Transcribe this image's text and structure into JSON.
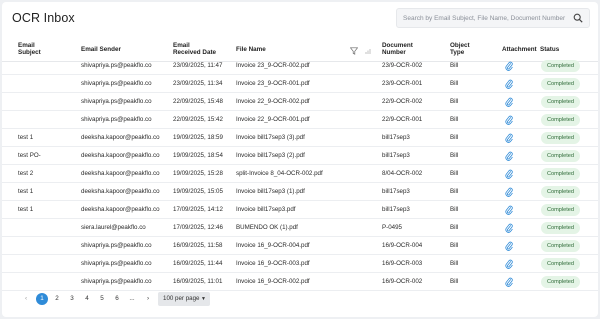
{
  "page": {
    "title": "OCR Inbox"
  },
  "search": {
    "placeholder": "Search by Email Subject, File Name, Document Number"
  },
  "table": {
    "columns": {
      "subject": [
        "Email",
        "Subject"
      ],
      "sender": "Email Sender",
      "received": [
        "Email",
        "Received Date"
      ],
      "file": "File Name",
      "doc": [
        "Document",
        "Number"
      ],
      "type": [
        "Object",
        "Type"
      ],
      "attachment": "Attachment",
      "status": "Status"
    },
    "rows": [
      {
        "subject": "",
        "sender": "shivapriya.ps@peakflo.co",
        "received": "23/09/2025, 11:47",
        "file": "Invoice 23_9-OCR-002.pdf",
        "doc": "23/9-OCR-002",
        "type": "Bill",
        "status": "Completed"
      },
      {
        "subject": "",
        "sender": "shivapriya.ps@peakflo.co",
        "received": "23/09/2025, 11:34",
        "file": "Invoice 23_9-OCR-001.pdf",
        "doc": "23/9-OCR-001",
        "type": "Bill",
        "status": "Completed"
      },
      {
        "subject": "",
        "sender": "shivapriya.ps@peakflo.co",
        "received": "22/09/2025, 15:48",
        "file": "Invoice 22_9-OCR-002.pdf",
        "doc": "22/9-OCR-002",
        "type": "Bill",
        "status": "Completed"
      },
      {
        "subject": "",
        "sender": "shivapriya.ps@peakflo.co",
        "received": "22/09/2025, 15:42",
        "file": "Invoice 22_9-OCR-001.pdf",
        "doc": "22/9-OCR-001",
        "type": "Bill",
        "status": "Completed"
      },
      {
        "subject": "test 1",
        "sender": "deeksha.kapoor@peakflo.co",
        "received": "19/09/2025, 18:59",
        "file": "Invoice bill17sep3 (3).pdf",
        "doc": "bill17sep3",
        "type": "Bill",
        "status": "Completed"
      },
      {
        "subject": "test PO-",
        "sender": "deeksha.kapoor@peakflo.co",
        "received": "19/09/2025, 18:54",
        "file": "Invoice bill17sep3 (2).pdf",
        "doc": "bill17sep3",
        "type": "Bill",
        "status": "Completed"
      },
      {
        "subject": "test 2",
        "sender": "deeksha.kapoor@peakflo.co",
        "received": "19/09/2025, 15:28",
        "file": "split-Invoice 8_04-OCR-002.pdf",
        "doc": "8/04-OCR-002",
        "type": "Bill",
        "status": "Completed"
      },
      {
        "subject": "test 1",
        "sender": "deeksha.kapoor@peakflo.co",
        "received": "19/09/2025, 15:05",
        "file": "Invoice bill17sep3 (1).pdf",
        "doc": "bill17sep3",
        "type": "Bill",
        "status": "Completed"
      },
      {
        "subject": "test 1",
        "sender": "deeksha.kapoor@peakflo.co",
        "received": "17/09/2025, 14:12",
        "file": "Invoice bill17sep3.pdf",
        "doc": "bill17sep3",
        "type": "Bill",
        "status": "Completed"
      },
      {
        "subject": "",
        "sender": "siera.laurel@peakflo.co",
        "received": "17/09/2025, 12:46",
        "file": "BUMENDO OK (1).pdf",
        "doc": "P-0495",
        "type": "Bill",
        "status": "Completed"
      },
      {
        "subject": "",
        "sender": "shivapriya.ps@peakflo.co",
        "received": "16/09/2025, 11:58",
        "file": "Invoice 16_9-OCR-004.pdf",
        "doc": "16/9-OCR-004",
        "type": "Bill",
        "status": "Completed"
      },
      {
        "subject": "",
        "sender": "shivapriya.ps@peakflo.co",
        "received": "16/09/2025, 11:44",
        "file": "Invoice 16_9-OCR-003.pdf",
        "doc": "16/9-OCR-003",
        "type": "Bill",
        "status": "Completed"
      },
      {
        "subject": "",
        "sender": "shivapriya.ps@peakflo.co",
        "received": "16/09/2025, 11:01",
        "file": "Invoice 16_9-OCR-002.pdf",
        "doc": "16/9-OCR-002",
        "type": "Bill",
        "status": "Completed"
      }
    ]
  },
  "pagination": {
    "prev": "‹",
    "next": "›",
    "pages": [
      "1",
      "2",
      "3",
      "4",
      "5",
      "6",
      "..."
    ],
    "active": "1",
    "per_page": "100 per page"
  },
  "colors": {
    "accent": "#2f8bd8",
    "badge_bg": "#e4f4e6",
    "badge_text": "#2f6b38"
  }
}
